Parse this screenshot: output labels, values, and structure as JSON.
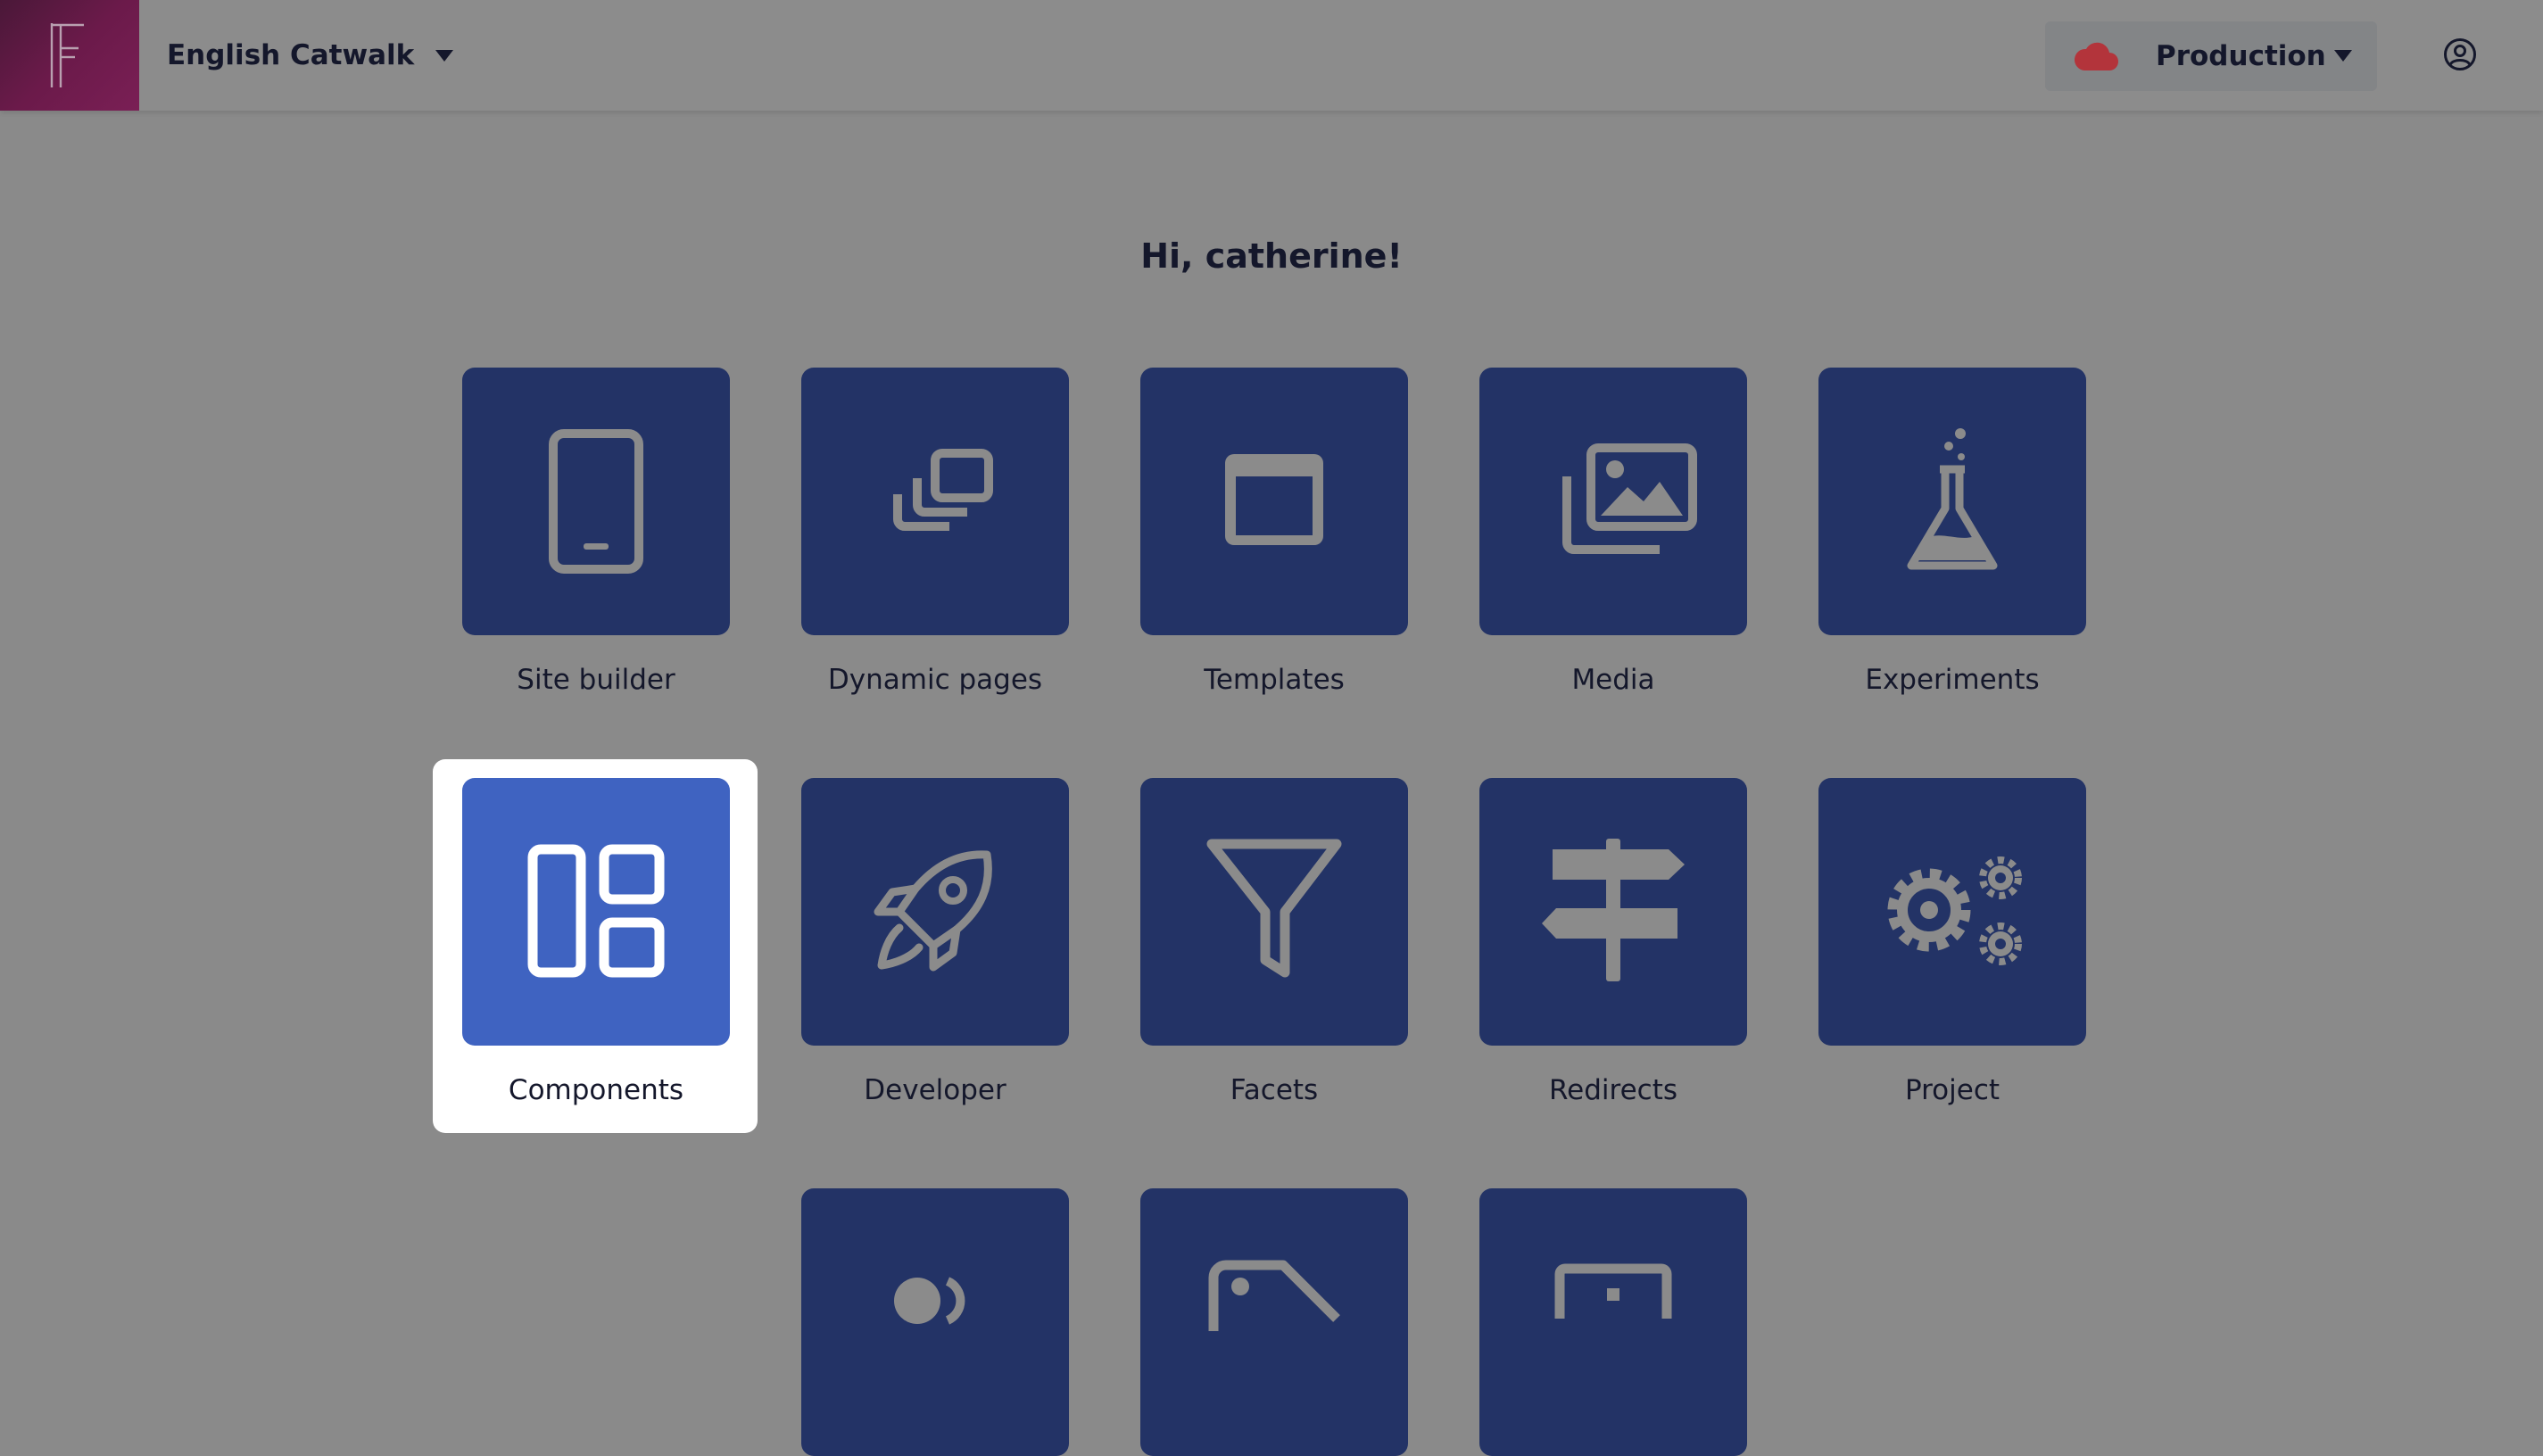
{
  "header": {
    "site_name": "English Catwalk",
    "environment": "Production",
    "env_icon_color": "#b3343b"
  },
  "greeting": "Hi, catherine!",
  "tiles": [
    {
      "label": "Site builder",
      "icon": "mobile-device-icon"
    },
    {
      "label": "Dynamic pages",
      "icon": "stacked-pages-icon"
    },
    {
      "label": "Templates",
      "icon": "window-template-icon"
    },
    {
      "label": "Media",
      "icon": "image-gallery-icon"
    },
    {
      "label": "Experiments",
      "icon": "flask-icon"
    },
    {
      "label": "Components",
      "icon": "layout-blocks-icon",
      "selected": true
    },
    {
      "label": "Developer",
      "icon": "rocket-icon"
    },
    {
      "label": "Facets",
      "icon": "filter-funnel-icon"
    },
    {
      "label": "Redirects",
      "icon": "signpost-icon"
    },
    {
      "label": "Project",
      "icon": "gears-icon"
    },
    {
      "label": "",
      "icon": "users-icon"
    },
    {
      "label": "",
      "icon": "tag-icon"
    },
    {
      "label": "",
      "icon": "archive-icon"
    }
  ]
}
